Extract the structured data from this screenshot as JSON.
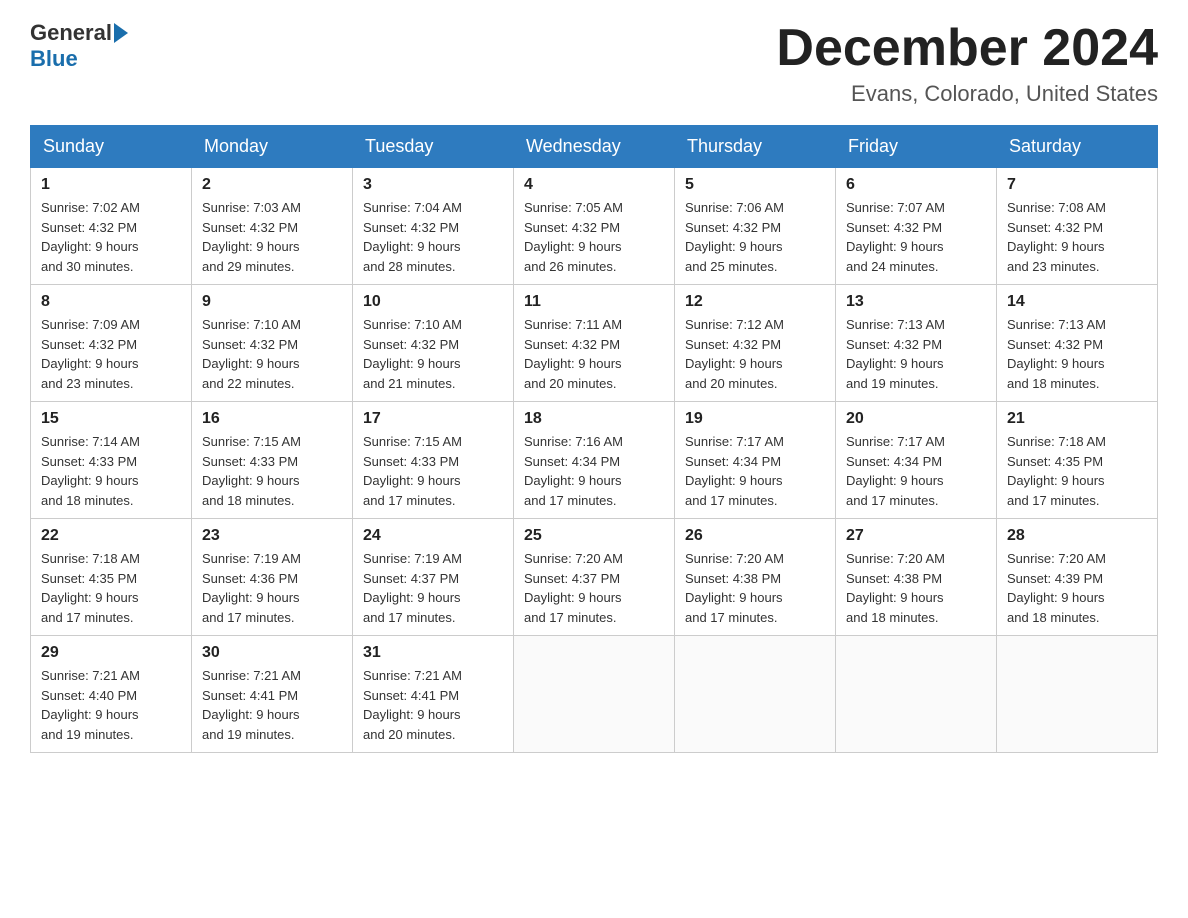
{
  "header": {
    "logo_general": "General",
    "logo_blue": "Blue",
    "month_title": "December 2024",
    "location": "Evans, Colorado, United States"
  },
  "days_of_week": [
    "Sunday",
    "Monday",
    "Tuesday",
    "Wednesday",
    "Thursday",
    "Friday",
    "Saturday"
  ],
  "weeks": [
    [
      {
        "day": "1",
        "sunrise": "7:02 AM",
        "sunset": "4:32 PM",
        "daylight": "9 hours and 30 minutes."
      },
      {
        "day": "2",
        "sunrise": "7:03 AM",
        "sunset": "4:32 PM",
        "daylight": "9 hours and 29 minutes."
      },
      {
        "day": "3",
        "sunrise": "7:04 AM",
        "sunset": "4:32 PM",
        "daylight": "9 hours and 28 minutes."
      },
      {
        "day": "4",
        "sunrise": "7:05 AM",
        "sunset": "4:32 PM",
        "daylight": "9 hours and 26 minutes."
      },
      {
        "day": "5",
        "sunrise": "7:06 AM",
        "sunset": "4:32 PM",
        "daylight": "9 hours and 25 minutes."
      },
      {
        "day": "6",
        "sunrise": "7:07 AM",
        "sunset": "4:32 PM",
        "daylight": "9 hours and 24 minutes."
      },
      {
        "day": "7",
        "sunrise": "7:08 AM",
        "sunset": "4:32 PM",
        "daylight": "9 hours and 23 minutes."
      }
    ],
    [
      {
        "day": "8",
        "sunrise": "7:09 AM",
        "sunset": "4:32 PM",
        "daylight": "9 hours and 23 minutes."
      },
      {
        "day": "9",
        "sunrise": "7:10 AM",
        "sunset": "4:32 PM",
        "daylight": "9 hours and 22 minutes."
      },
      {
        "day": "10",
        "sunrise": "7:10 AM",
        "sunset": "4:32 PM",
        "daylight": "9 hours and 21 minutes."
      },
      {
        "day": "11",
        "sunrise": "7:11 AM",
        "sunset": "4:32 PM",
        "daylight": "9 hours and 20 minutes."
      },
      {
        "day": "12",
        "sunrise": "7:12 AM",
        "sunset": "4:32 PM",
        "daylight": "9 hours and 20 minutes."
      },
      {
        "day": "13",
        "sunrise": "7:13 AM",
        "sunset": "4:32 PM",
        "daylight": "9 hours and 19 minutes."
      },
      {
        "day": "14",
        "sunrise": "7:13 AM",
        "sunset": "4:32 PM",
        "daylight": "9 hours and 18 minutes."
      }
    ],
    [
      {
        "day": "15",
        "sunrise": "7:14 AM",
        "sunset": "4:33 PM",
        "daylight": "9 hours and 18 minutes."
      },
      {
        "day": "16",
        "sunrise": "7:15 AM",
        "sunset": "4:33 PM",
        "daylight": "9 hours and 18 minutes."
      },
      {
        "day": "17",
        "sunrise": "7:15 AM",
        "sunset": "4:33 PM",
        "daylight": "9 hours and 17 minutes."
      },
      {
        "day": "18",
        "sunrise": "7:16 AM",
        "sunset": "4:34 PM",
        "daylight": "9 hours and 17 minutes."
      },
      {
        "day": "19",
        "sunrise": "7:17 AM",
        "sunset": "4:34 PM",
        "daylight": "9 hours and 17 minutes."
      },
      {
        "day": "20",
        "sunrise": "7:17 AM",
        "sunset": "4:34 PM",
        "daylight": "9 hours and 17 minutes."
      },
      {
        "day": "21",
        "sunrise": "7:18 AM",
        "sunset": "4:35 PM",
        "daylight": "9 hours and 17 minutes."
      }
    ],
    [
      {
        "day": "22",
        "sunrise": "7:18 AM",
        "sunset": "4:35 PM",
        "daylight": "9 hours and 17 minutes."
      },
      {
        "day": "23",
        "sunrise": "7:19 AM",
        "sunset": "4:36 PM",
        "daylight": "9 hours and 17 minutes."
      },
      {
        "day": "24",
        "sunrise": "7:19 AM",
        "sunset": "4:37 PM",
        "daylight": "9 hours and 17 minutes."
      },
      {
        "day": "25",
        "sunrise": "7:20 AM",
        "sunset": "4:37 PM",
        "daylight": "9 hours and 17 minutes."
      },
      {
        "day": "26",
        "sunrise": "7:20 AM",
        "sunset": "4:38 PM",
        "daylight": "9 hours and 17 minutes."
      },
      {
        "day": "27",
        "sunrise": "7:20 AM",
        "sunset": "4:38 PM",
        "daylight": "9 hours and 18 minutes."
      },
      {
        "day": "28",
        "sunrise": "7:20 AM",
        "sunset": "4:39 PM",
        "daylight": "9 hours and 18 minutes."
      }
    ],
    [
      {
        "day": "29",
        "sunrise": "7:21 AM",
        "sunset": "4:40 PM",
        "daylight": "9 hours and 19 minutes."
      },
      {
        "day": "30",
        "sunrise": "7:21 AM",
        "sunset": "4:41 PM",
        "daylight": "9 hours and 19 minutes."
      },
      {
        "day": "31",
        "sunrise": "7:21 AM",
        "sunset": "4:41 PM",
        "daylight": "9 hours and 20 minutes."
      },
      null,
      null,
      null,
      null
    ]
  ],
  "labels": {
    "sunrise": "Sunrise:",
    "sunset": "Sunset:",
    "daylight": "Daylight:"
  }
}
